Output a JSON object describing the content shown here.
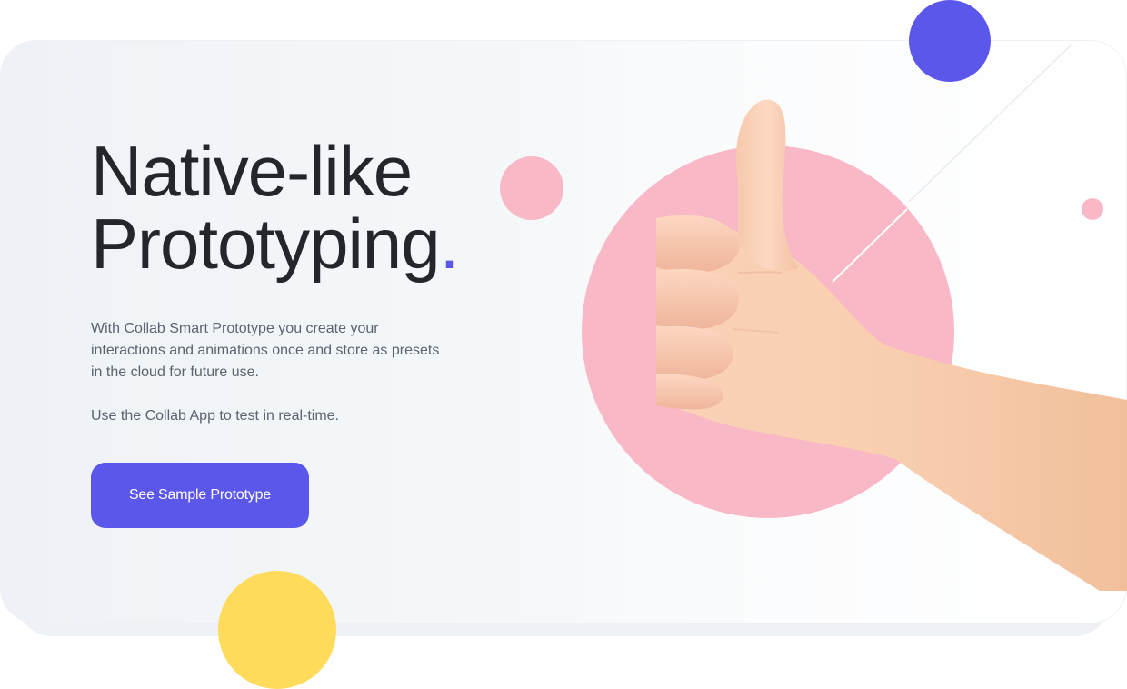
{
  "hero": {
    "title_line1": "Native-like",
    "title_line2": "Prototyping",
    "title_dot": ".",
    "description": "With Collab Smart Prototype you create your interactions and animations once and store as presets in the cloud for future use.",
    "note": "Use the Collab App to test in real-time.",
    "cta_label": "See Sample Prototype"
  },
  "colors": {
    "accent": "#5b57ea",
    "pink": "#f8b8c6",
    "yellow": "#ffdb5c",
    "heading": "#23262b",
    "body_text": "#5d6270"
  },
  "illustration": {
    "icon": "thumbs-up-hand-icon"
  }
}
